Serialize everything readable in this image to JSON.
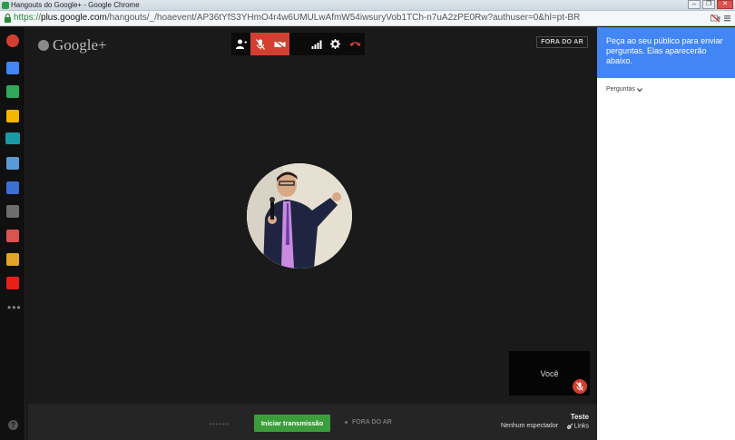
{
  "window": {
    "title": "Hangouts do Google+ - Google Chrome",
    "controls": [
      "minimize",
      "restore",
      "close"
    ]
  },
  "addressbar": {
    "scheme": "https://",
    "host": "plus.google.com",
    "path": "/hangouts/_/hoaevent/AP36tYfS3YHmO4r4w6UMULwAfmW54iwsuryVob1TCh-n7uA2zPE0Rw?authuser=0&hl=pt-BR"
  },
  "rail": {
    "icons": [
      "google-plus-notifications-icon",
      "messages-icon",
      "share-icon",
      "tags-icon",
      "dia-app-icon",
      "camera-icon",
      "video-icon",
      "film-icon",
      "tv-icon",
      "photos-icon",
      "youtube-icon"
    ],
    "more": "•••",
    "help": "?"
  },
  "header": {
    "brand": "Google+",
    "status_badge": "FORA DO AR"
  },
  "toolbar": {
    "buttons": [
      "invite-icon",
      "mic-muted-icon",
      "camera-off-icon",
      "bandwidth-icon",
      "settings-icon",
      "hang-up-icon"
    ]
  },
  "self_view": {
    "label": "Você"
  },
  "broadcast": {
    "dots": "••••••",
    "start_button": "Iniciar transmissão",
    "status": "FORA DO AR",
    "title": "Teste",
    "viewers": "Nenhum espectador",
    "links": "Links"
  },
  "qa_panel": {
    "header_text": "Peça ao seu público para enviar perguntas. Elas aparecerão abaixo.",
    "filter_label": "Perguntas"
  },
  "colors": {
    "accent_blue": "#4285f4",
    "mute_red": "#d23f31",
    "start_green": "#3b9e3b"
  }
}
